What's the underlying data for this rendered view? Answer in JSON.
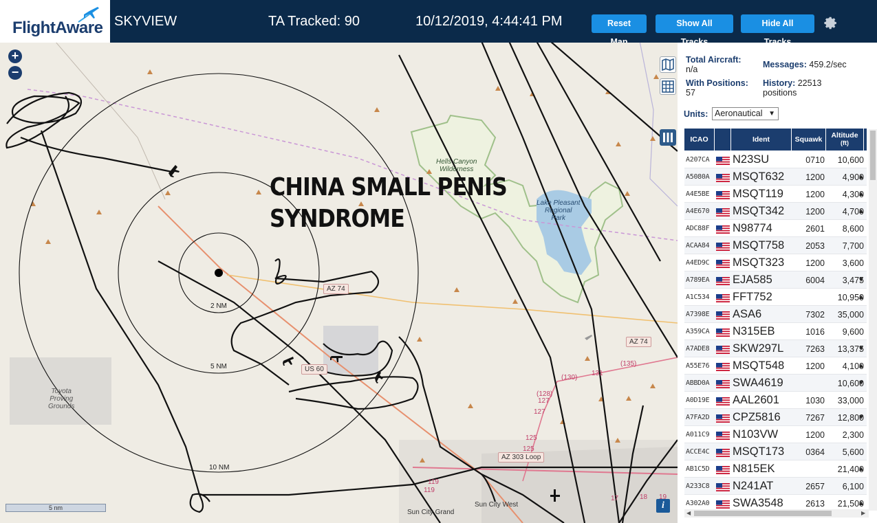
{
  "header": {
    "logo": "FlightAware",
    "app_title": "SKYVIEW",
    "ta_tracked": "TA Tracked: 90",
    "datetime": "10/12/2019, 4:44:41 PM",
    "buttons": {
      "reset": "Reset Map",
      "show": "Show All Tracks",
      "hide": "Hide All Tracks"
    }
  },
  "map": {
    "overlay_line1": "CHINA SMALL PENIS",
    "overlay_line2": "SYNDROME",
    "rings": {
      "r2": "2 NM",
      "r5": "5 NM",
      "r10": "10 NM"
    },
    "scale": "5 nm",
    "labels": {
      "hells_canyon_1": "Hells Canyon",
      "hells_canyon_2": "Wilderness",
      "lake_1": "Lake Pleasant",
      "lake_2": "Regional",
      "lake_3": "Park",
      "toyota_1": "Toyota",
      "toyota_2": "Proving",
      "toyota_3": "Grounds",
      "sun_city_grand": "Sun City Grand",
      "sun_city_west": "Sun City West"
    },
    "highways": {
      "az74_a": "AZ 74",
      "az74_b": "AZ 74",
      "us60": "US 60",
      "az303": "AZ 303 Loop"
    },
    "road_numbers": [
      "(130)",
      "(128)",
      "127",
      "127",
      "131",
      "(135)",
      "125",
      "125",
      "119",
      "119",
      "17",
      "18",
      "19"
    ],
    "zoom_in": "+",
    "zoom_out": "−",
    "info": "i",
    "colors": {
      "map_bg": "#efece4",
      "park_border": "#9fc08a",
      "water": "#a9cbe4",
      "track": "#111111"
    }
  },
  "panel": {
    "stats": {
      "total_label": "Total Aircraft:",
      "total_value": "n/a",
      "messages_label": "Messages:",
      "messages_value": "459.2/sec",
      "positions_label": "With Positions:",
      "positions_value": "57",
      "history_label": "History:",
      "history_value": "22513",
      "history_unit": "positions"
    },
    "units_label": "Units:",
    "units_value": "Aeronautical",
    "columns": {
      "icao": "ICAO",
      "ident": "Ident",
      "squawk": "Squawk",
      "alt1": "Altitude",
      "alt2": "(ft)"
    },
    "rows": [
      {
        "icao": "A207CA",
        "ident": "N23SU",
        "squawk": "0710",
        "alt": "10,600",
        "trend": ""
      },
      {
        "icao": "A5080A",
        "ident": "MSQT632",
        "squawk": "1200",
        "alt": "4,900",
        "trend": "▲"
      },
      {
        "icao": "A4E5BE",
        "ident": "MSQT119",
        "squawk": "1200",
        "alt": "4,300",
        "trend": "▲"
      },
      {
        "icao": "A4E670",
        "ident": "MSQT342",
        "squawk": "1200",
        "alt": "4,700",
        "trend": "▲"
      },
      {
        "icao": "ADC88F",
        "ident": "N98774",
        "squawk": "2601",
        "alt": "8,600",
        "trend": ""
      },
      {
        "icao": "ACAA84",
        "ident": "MSQT758",
        "squawk": "2053",
        "alt": "7,700",
        "trend": ""
      },
      {
        "icao": "A4ED9C",
        "ident": "MSQT323",
        "squawk": "1200",
        "alt": "3,600",
        "trend": ""
      },
      {
        "icao": "A789EA",
        "ident": "EJA585",
        "squawk": "6004",
        "alt": "3,475",
        "trend": "▼"
      },
      {
        "icao": "A1C534",
        "ident": "FFT752",
        "squawk": "",
        "alt": "10,950",
        "trend": "▲"
      },
      {
        "icao": "A7398E",
        "ident": "ASA6",
        "squawk": "7302",
        "alt": "35,000",
        "trend": ""
      },
      {
        "icao": "A359CA",
        "ident": "N315EB",
        "squawk": "1016",
        "alt": "9,600",
        "trend": ""
      },
      {
        "icao": "A7ADE8",
        "ident": "SKW297L",
        "squawk": "7263",
        "alt": "13,375",
        "trend": "▼"
      },
      {
        "icao": "A55E76",
        "ident": "MSQT548",
        "squawk": "1200",
        "alt": "4,100",
        "trend": "▲"
      },
      {
        "icao": "ABBD0A",
        "ident": "SWA4619",
        "squawk": "",
        "alt": "10,600",
        "trend": "▼"
      },
      {
        "icao": "A0D19E",
        "ident": "AAL2601",
        "squawk": "1030",
        "alt": "33,000",
        "trend": ""
      },
      {
        "icao": "A7FA2D",
        "ident": "CPZ5816",
        "squawk": "7267",
        "alt": "12,800",
        "trend": "▼"
      },
      {
        "icao": "A011C9",
        "ident": "N103VW",
        "squawk": "1200",
        "alt": "2,300",
        "trend": ""
      },
      {
        "icao": "ACCE4C",
        "ident": "MSQT173",
        "squawk": "0364",
        "alt": "5,600",
        "trend": ""
      },
      {
        "icao": "AB1C5D",
        "ident": "N815EK",
        "squawk": "",
        "alt": "21,400",
        "trend": "▲"
      },
      {
        "icao": "A233C8",
        "ident": "N241AT",
        "squawk": "2657",
        "alt": "6,100",
        "trend": ""
      },
      {
        "icao": "A302A0",
        "ident": "SWA3548",
        "squawk": "2613",
        "alt": "21,500",
        "trend": "▲"
      }
    ]
  }
}
